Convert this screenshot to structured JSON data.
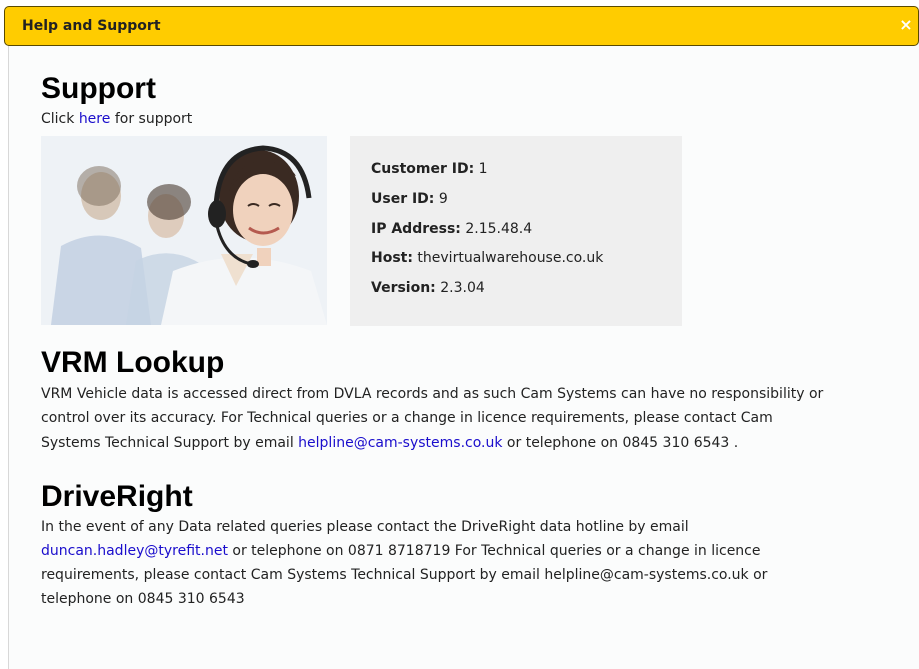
{
  "dialog": {
    "title": "Help and Support",
    "close_label": "×"
  },
  "support": {
    "heading": "Support",
    "click_prefix": "Click ",
    "link_label": "here",
    "click_suffix": " for support"
  },
  "info": {
    "customer_id_label": "Customer ID:",
    "customer_id": "1",
    "user_id_label": "User ID:",
    "user_id": "9",
    "ip_label": "IP Address:",
    "ip": "2.15.48.4",
    "host_label": "Host:",
    "host": "thevirtualwarehouse.co.uk",
    "version_label": "Version:",
    "version": "2.3.04"
  },
  "vrm": {
    "heading": "VRM Lookup",
    "line1": "VRM Vehicle data is accessed direct from DVLA records and as such Cam Systems can have no responsibility or",
    "line2": "control over its accuracy. For Technical queries or a change in licence requirements, please contact Cam",
    "line3_prefix": "Systems Technical Support by email ",
    "email": "helpline@cam-systems.co.uk",
    "line3_suffix": " or telephone on 0845 310 6543 ."
  },
  "driveright": {
    "heading": "DriveRight",
    "line1": "In the event of any Data related queries please contact the DriveRight data hotline by email",
    "email": "duncan.hadley@tyrefit.net",
    "line2_suffix": " or telephone on 0871 8718719 For Technical queries or a change in licence",
    "line3": "requirements, please contact Cam Systems Technical Support by email helpline@cam-systems.co.uk or",
    "line4": "telephone on 0845 310 6543"
  }
}
